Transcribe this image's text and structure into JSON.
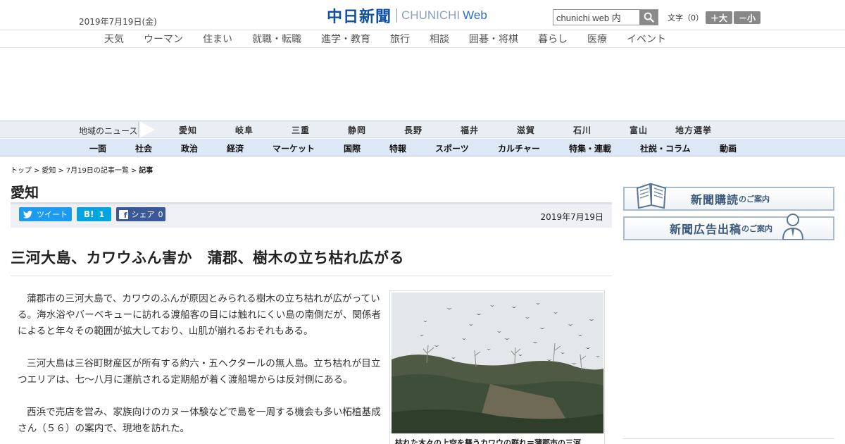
{
  "header": {
    "date": "2019年7月19日(金)",
    "logo_kanji": "中日新聞",
    "logo_en": "CHUNICHI",
    "logo_web": "Web",
    "search_placeholder": "chunichi web 内",
    "font_size_label": "文字（0）",
    "font_larger": "＋大",
    "font_smaller": "－小"
  },
  "top_nav": [
    "天気",
    "ウーマン",
    "住まい",
    "就職・転職",
    "進学・教育",
    "旅行",
    "相談",
    "囲碁・将棋",
    "暮らし",
    "医療",
    "イベント"
  ],
  "region_nav": {
    "label": "地域のニュース",
    "items": [
      "愛知",
      "岐阜",
      "三重",
      "静岡",
      "長野",
      "福井",
      "滋賀",
      "石川",
      "富山",
      "地方選挙"
    ]
  },
  "category_nav": [
    "一面",
    "社会",
    "政治",
    "経済",
    "マーケット",
    "国際",
    "特報",
    "スポーツ",
    "カルチャー",
    "特集・連載",
    "社説・コラム",
    "動画"
  ],
  "breadcrumb": [
    "トップ",
    ">",
    "愛知",
    ">",
    "7月19日の記事一覧",
    ">",
    "記事"
  ],
  "section_title": "愛知",
  "share": {
    "tweet": "ツイート",
    "hatena": "1",
    "hatena_logo": "B!",
    "facebook": "シェア",
    "facebook_count": "0"
  },
  "article": {
    "date": "2019年7月19日",
    "headline": "三河大島、カワウふん害か　蒲郡、樹木の立ち枯れ広がる",
    "paragraphs": [
      "蒲郡市の三河大島で、カワウのふんが原因とみられる樹木の立ち枯れが広がっている。海水浴やバーベキューに訪れる渡船客の目には触れにくい島の南側だが、関係者によると年々その範囲が拡大しており、山肌が崩れるおそれもある。",
      "三河大島は三谷町財産区が所有する約六・五ヘクタールの無人島。立ち枯れが目立つエリアは、七～八月に運航される定期船が着く渡船場からは反対側にある。",
      "西浜で売店を営み、家族向けのカヌー体験などで島を一周する機会も多い柘植基成さん（５６）の案内で、現地を訪れた。"
    ],
    "photo_caption": "枯れた木々の上空を舞うカワウの群れ＝蒲郡市の三河"
  },
  "sidebar": {
    "banner1_big": "新聞購読",
    "banner1_small": "のご案内",
    "banner2_big": "新聞広告出稿",
    "banner2_small": "のご案内"
  },
  "colors": {
    "brand_blue": "#0f4fa6",
    "twitter": "#1d9bf0",
    "hatena": "#00a4de",
    "facebook": "#3b5998"
  }
}
